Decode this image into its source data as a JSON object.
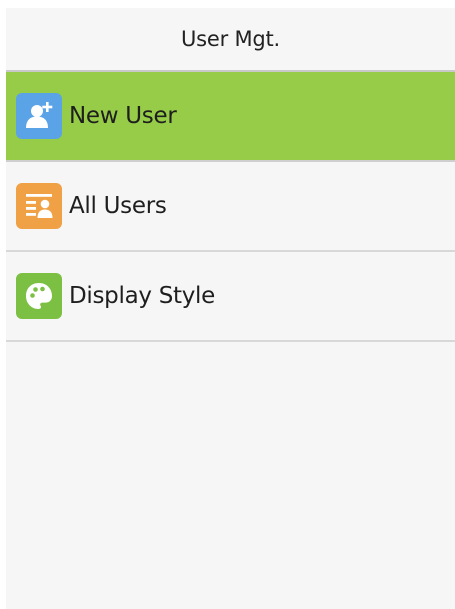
{
  "header": {
    "title": "User Mgt."
  },
  "menu": {
    "items": [
      {
        "label": "New User",
        "icon": "add-user-icon",
        "color": "#5aa3e6",
        "selected": true
      },
      {
        "label": "All Users",
        "icon": "user-list-icon",
        "color": "#f0a045",
        "selected": false
      },
      {
        "label": "Display Style",
        "icon": "palette-icon",
        "color": "#7cc043",
        "selected": false
      }
    ]
  },
  "colors": {
    "selected_background": "#96cc48",
    "screen_background": "#f6f6f6"
  }
}
